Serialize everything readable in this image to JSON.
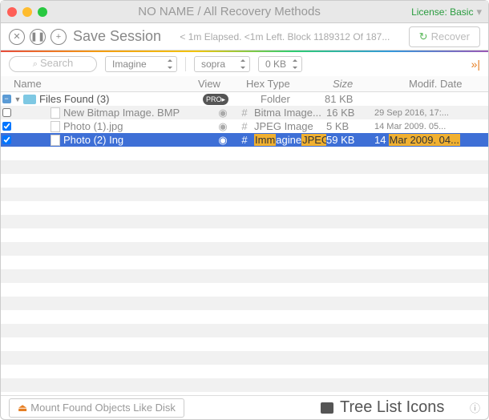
{
  "titlebar": {
    "title": "NO NAME / All Recovery Methods",
    "license": "License: Basic"
  },
  "toolbar": {
    "save": "Save Session",
    "status": "< 1m Elapsed. <1m Left. Block 1189312 Of 187...",
    "recover": "Recover"
  },
  "filters": {
    "search": "Search",
    "dd1": "Imagine",
    "dd2": "sopra",
    "dd3": "0 KB"
  },
  "headers": {
    "c1": "Name",
    "c2": "View",
    "c3": "Hex Type",
    "c4": "Size",
    "c5": "Modif. Date"
  },
  "rows": [
    {
      "name": "Files Found (3)",
      "type": "Folder",
      "size": "81 KB",
      "badge": "PRO▸"
    },
    {
      "name": "New Bitmap Image. BMP",
      "type": "Bitma Image...",
      "size": "16 KB",
      "date": "29 Sep 2016, 17:..."
    },
    {
      "name": "Photo (1).jpg",
      "type": "JPEG Image",
      "size": "5 KB",
      "date": "14 Mar 2009. 05..."
    },
    {
      "name": "Photo (2) Ing",
      "type_a": "Imm",
      "type_b": "agine",
      "type_c": "JPEG",
      "size": "59 KB",
      "date_a": "14",
      "date_b": "Mar 2009. 04..."
    }
  ],
  "footer": {
    "mount": "Mount Found Objects Like Disk",
    "view": "Tree List Icons"
  }
}
